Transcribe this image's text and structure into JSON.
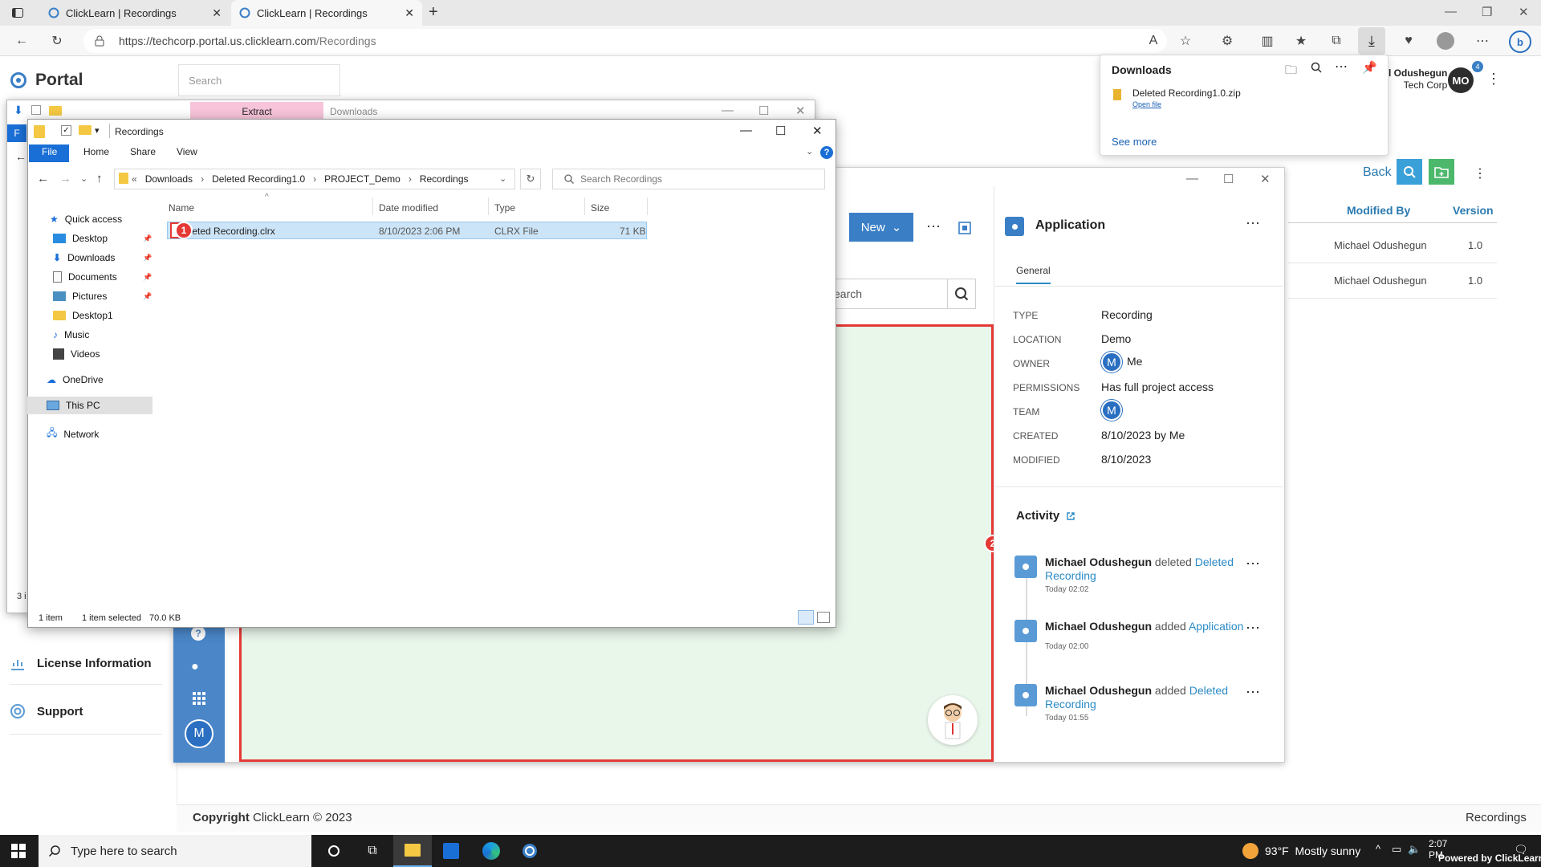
{
  "browser": {
    "tabs": [
      {
        "title": "ClickLearn | Recordings"
      },
      {
        "title": "ClickLearn | Recordings"
      }
    ],
    "url_prefix": "https://techcorp.portal.us.clicklearn.com",
    "url_path": "/Recordings"
  },
  "downloads_panel": {
    "title": "Downloads",
    "file_name": "Deleted Recording1.0.zip",
    "open_link": "Open file",
    "see_more": "See more",
    "badge_count": "4"
  },
  "portal": {
    "logo_text": "Portal",
    "search_placeholder": "Search",
    "user_name": "l Odushegun",
    "user_company": "Tech Corp",
    "user_initials": "MO",
    "nav": {
      "license": "License Information",
      "support": "Support"
    },
    "copyright_label": "Copyright",
    "copyright_text": "ClickLearn © 2023",
    "footer_right": "Recordings",
    "back_label": "Back",
    "table": {
      "headers": [
        "Modified By",
        "Version"
      ],
      "rows": [
        {
          "modified_by": "Michael Odushegun",
          "version": "1.0"
        },
        {
          "modified_by": "Michael Odushegun",
          "version": "1.0"
        }
      ]
    }
  },
  "app": {
    "new_button": "New",
    "search_placeholder": "earch",
    "avatar_initial": "M",
    "panel_title": "Application",
    "panel_tab": "General",
    "properties": [
      {
        "label": "TYPE",
        "value": "Recording"
      },
      {
        "label": "LOCATION",
        "value": "Demo"
      },
      {
        "label": "OWNER",
        "value": "Me"
      },
      {
        "label": "PERMISSIONS",
        "value": "Has full project access"
      },
      {
        "label": "TEAM",
        "value": ""
      },
      {
        "label": "CREATED",
        "value": "8/10/2023 by Me"
      },
      {
        "label": "MODIFIED",
        "value": "8/10/2023"
      }
    ],
    "badge_initial": "M",
    "activity_title": "Activity",
    "activity": [
      {
        "who": "Michael Odushegun",
        "verb": "deleted",
        "link": "Deleted Recording",
        "time": "Today 02:02"
      },
      {
        "who": "Michael Odushegun",
        "verb": "added",
        "link": "Application",
        "time": "Today 02:00"
      },
      {
        "who": "Michael Odushegun",
        "verb": "added",
        "link": "Deleted Recording",
        "time": "Today 01:55"
      }
    ]
  },
  "markers": {
    "one": "1",
    "two": "2"
  },
  "explorer_back": {
    "extract_tab": "Extract",
    "title": "Downloads",
    "file_tab": "F",
    "status": "3 i"
  },
  "explorer": {
    "title": "Recordings",
    "ribbon_tabs": [
      "File",
      "Home",
      "Share",
      "View"
    ],
    "breadcrumb": [
      "Downloads",
      "Deleted Recording1.0",
      "PROJECT_Demo",
      "Recordings"
    ],
    "search_placeholder": "Search Recordings",
    "nav": {
      "quick_access": "Quick access",
      "desktop": "Desktop",
      "downloads": "Downloads",
      "documents": "Documents",
      "pictures": "Pictures",
      "desktop1": "Desktop1",
      "music": "Music",
      "videos": "Videos",
      "onedrive": "OneDrive",
      "this_pc": "This PC",
      "network": "Network"
    },
    "columns": {
      "name": "Name",
      "date": "Date modified",
      "type": "Type",
      "size": "Size"
    },
    "file": {
      "name": "eleted Recording.clrx",
      "date": "8/10/2023 2:06 PM",
      "type": "CLRX File",
      "size": "71 KB"
    },
    "status_items": "1 item",
    "status_selected": "1 item selected",
    "status_size": "70.0 KB"
  },
  "taskbar": {
    "search_placeholder": "Type here to search",
    "weather_temp": "93°F",
    "weather_text": "Mostly sunny",
    "time": "2:07 PM",
    "watermark": "Powered by ClickLearn"
  },
  "colors": {
    "accent": "#3a7fc6",
    "highlight": "#e53935",
    "app_strip": "#4a86c8",
    "green_area": "#e9f6ea",
    "link": "#2a8ac6"
  }
}
